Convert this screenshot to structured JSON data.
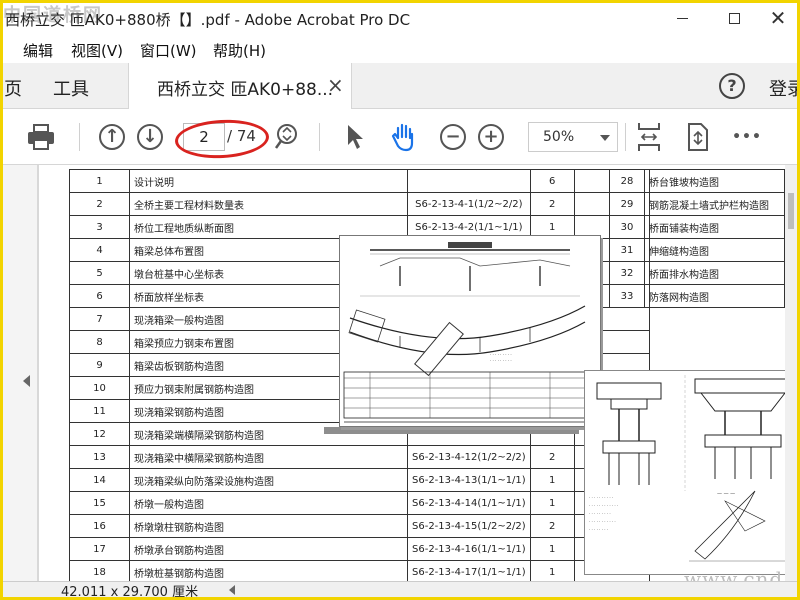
{
  "window": {
    "title": "西桥立交 匝AK0+880桥【】.pdf - Adobe Acrobat Pro DC",
    "watermark_logo": "中国道桥网",
    "minimize_icon": "minimize-icon",
    "maximize_icon": "maximize-icon",
    "close_symbol": "✕"
  },
  "menu": {
    "items": [
      {
        "label": "编辑"
      },
      {
        "label": "视图(V)"
      },
      {
        "label": "窗口(W)"
      },
      {
        "label": "帮助(H)"
      }
    ]
  },
  "tabs": {
    "home": "页",
    "tools": "工具",
    "document": "西桥立交 匝AK0+88...",
    "close_symbol": "×",
    "help_symbol": "?",
    "login": "登录"
  },
  "toolbar": {
    "current_page": "2",
    "total_pages": "/ 74",
    "zoom": "50%",
    "prev_symbol": "↑",
    "next_symbol": "↓",
    "zoom_out_symbol": "−",
    "zoom_in_symbol": "+",
    "more_symbol": "•••",
    "highlight_color": "#d9231f"
  },
  "index_table_left": {
    "rows": [
      {
        "no": "1",
        "name": "设计说明",
        "code": "",
        "pages": "6"
      },
      {
        "no": "2",
        "name": "全桥主要工程材料数量表",
        "code": "S6-2-13-4-1(1/2~2/2)",
        "pages": "2"
      },
      {
        "no": "3",
        "name": "桥位工程地质纵断面图",
        "code": "S6-2-13-4-2(1/1~1/1)",
        "pages": "1"
      },
      {
        "no": "4",
        "name": "箱梁总体布置图",
        "code": "",
        "pages": ""
      },
      {
        "no": "5",
        "name": "墩台桩基中心坐标表",
        "code": "",
        "pages": ""
      },
      {
        "no": "6",
        "name": "桥面放样坐标表",
        "code": "",
        "pages": ""
      },
      {
        "no": "7",
        "name": "现浇箱梁一般构造图",
        "code": "",
        "pages": ""
      },
      {
        "no": "8",
        "name": "箱梁预应力钢束布置图",
        "code": "",
        "pages": ""
      },
      {
        "no": "9",
        "name": "箱梁齿板钢筋构造图",
        "code": "",
        "pages": ""
      },
      {
        "no": "10",
        "name": "预应力钢束附属钢筋构造图",
        "code": "",
        "pages": ""
      },
      {
        "no": "11",
        "name": "现浇箱梁钢筋构造图",
        "code": "",
        "pages": ""
      },
      {
        "no": "12",
        "name": "现浇箱梁端横隔梁钢筋构造图",
        "code": "",
        "pages": ""
      },
      {
        "no": "13",
        "name": "现浇箱梁中横隔梁钢筋构造图",
        "code": "S6-2-13-4-12(1/2~2/2)",
        "pages": "2"
      },
      {
        "no": "14",
        "name": "现浇箱梁纵向防落梁设施构造图",
        "code": "S6-2-13-4-13(1/1~1/1)",
        "pages": "1"
      },
      {
        "no": "15",
        "name": "桥墩一般构造图",
        "code": "S6-2-13-4-14(1/1~1/1)",
        "pages": "1"
      },
      {
        "no": "16",
        "name": "桥墩墩柱钢筋构造图",
        "code": "S6-2-13-4-15(1/2~2/2)",
        "pages": "2"
      },
      {
        "no": "17",
        "name": "桥墩承台钢筋构造图",
        "code": "S6-2-13-4-16(1/1~1/1)",
        "pages": "1"
      },
      {
        "no": "18",
        "name": "桥墩桩基钢筋构造图",
        "code": "S6-2-13-4-17(1/1~1/1)",
        "pages": "1"
      }
    ]
  },
  "index_table_right": {
    "rows": [
      {
        "no": "28",
        "name": "桥台锥坡构造图"
      },
      {
        "no": "29",
        "name": "钢筋混凝土墙式护栏构造图"
      },
      {
        "no": "30",
        "name": "桥面铺装构造图"
      },
      {
        "no": "31",
        "name": "伸缩缝构造图"
      },
      {
        "no": "32",
        "name": "桥面排水构造图"
      },
      {
        "no": "33",
        "name": "防落网构造图"
      }
    ]
  },
  "watermark_site": "www.cndao.com",
  "statusbar": {
    "dimensions": "42.011 x 29.700 厘米"
  }
}
